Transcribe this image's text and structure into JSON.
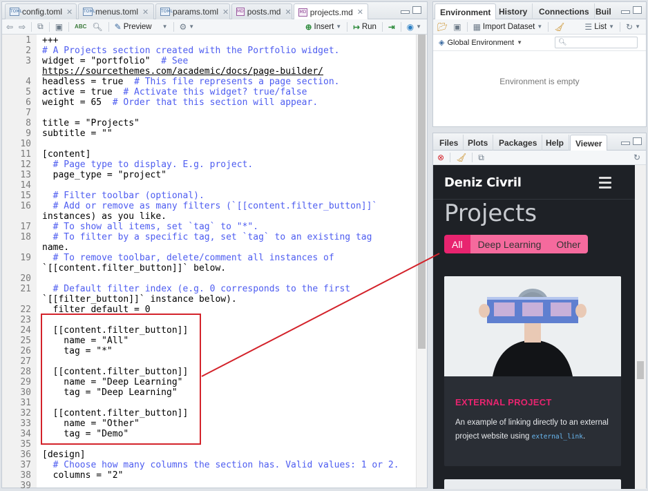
{
  "editor": {
    "tabs": [
      {
        "label": "config.toml",
        "icon": "toml-file-icon",
        "badge": "TOML"
      },
      {
        "label": "menus.toml",
        "icon": "toml-file-icon",
        "badge": "TOML"
      },
      {
        "label": "params.toml",
        "icon": "toml-file-icon",
        "badge": "TOML"
      },
      {
        "label": "posts.md",
        "icon": "md-file-icon",
        "badge": "MD"
      },
      {
        "label": "projects.md",
        "icon": "md-file-icon",
        "badge": "MD",
        "active": true
      }
    ],
    "toolbar": {
      "preview_label": "Preview",
      "insert_label": "Insert",
      "run_label": "Run",
      "spellcheck_badge": "ABC"
    },
    "code_lines": [
      {
        "n": "1",
        "text": "+++"
      },
      {
        "n": "2",
        "text": "# A Projects section created with the Portfolio widget.",
        "comment": true
      },
      {
        "n": "3",
        "text": "widget = \"portfolio\"  # See"
      },
      {
        "n": "",
        "text": "https://sourcethemes.com/academic/docs/page-builder/",
        "url": true
      },
      {
        "n": "4",
        "text": "headless = true  # This file represents a page section."
      },
      {
        "n": "5",
        "text": "active = true  # Activate this widget? true/false"
      },
      {
        "n": "6",
        "text": "weight = 65  # Order that this section will appear."
      },
      {
        "n": "7",
        "text": ""
      },
      {
        "n": "8",
        "text": "title = \"Projects\""
      },
      {
        "n": "9",
        "text": "subtitle = \"\""
      },
      {
        "n": "10",
        "text": ""
      },
      {
        "n": "11",
        "text": "[content]"
      },
      {
        "n": "12",
        "text": "  # Page type to display. E.g. project."
      },
      {
        "n": "13",
        "text": "  page_type = \"project\""
      },
      {
        "n": "14",
        "text": ""
      },
      {
        "n": "15",
        "text": "  # Filter toolbar (optional)."
      },
      {
        "n": "16",
        "text": "  # Add or remove as many filters (`[[content.filter_button]]`"
      },
      {
        "n": "",
        "text": "instances) as you like."
      },
      {
        "n": "17",
        "text": "  # To show all items, set `tag` to \"*\"."
      },
      {
        "n": "18",
        "text": "  # To filter by a specific tag, set `tag` to an existing tag"
      },
      {
        "n": "",
        "text": "name."
      },
      {
        "n": "19",
        "text": "  # To remove toolbar, delete/comment all instances of"
      },
      {
        "n": "",
        "text": "`[[content.filter_button]]` below."
      },
      {
        "n": "20",
        "text": ""
      },
      {
        "n": "21",
        "text": "  # Default filter index (e.g. 0 corresponds to the first"
      },
      {
        "n": "",
        "text": "`[[filter_button]]` instance below)."
      },
      {
        "n": "22",
        "text": "  filter_default = 0"
      },
      {
        "n": "23",
        "text": ""
      },
      {
        "n": "24",
        "text": "  [[content.filter_button]]"
      },
      {
        "n": "25",
        "text": "    name = \"All\""
      },
      {
        "n": "26",
        "text": "    tag = \"*\""
      },
      {
        "n": "27",
        "text": ""
      },
      {
        "n": "28",
        "text": "  [[content.filter_button]]"
      },
      {
        "n": "29",
        "text": "    name = \"Deep Learning\""
      },
      {
        "n": "30",
        "text": "    tag = \"Deep Learning\""
      },
      {
        "n": "31",
        "text": ""
      },
      {
        "n": "32",
        "text": "  [[content.filter_button]]"
      },
      {
        "n": "33",
        "text": "    name = \"Other\""
      },
      {
        "n": "34",
        "text": "    tag = \"Demo\""
      },
      {
        "n": "35",
        "text": ""
      },
      {
        "n": "36",
        "text": "[design]"
      },
      {
        "n": "37",
        "text": "  # Choose how many columns the section has. Valid values: 1 or 2."
      },
      {
        "n": "38",
        "text": "  columns = \"2\""
      },
      {
        "n": "39",
        "text": ""
      }
    ]
  },
  "env_pane": {
    "tabs": [
      "Environment",
      "History",
      "Connections",
      "Buil"
    ],
    "import_label": "Import Dataset",
    "list_label": "List",
    "scope_label": "Global Environment",
    "empty_message": "Environment is empty"
  },
  "viewer_pane": {
    "tabs": [
      "Files",
      "Plots",
      "Packages",
      "Help",
      "Viewer"
    ],
    "site": {
      "brand": "Deniz Civril",
      "section_title": "Projects",
      "filters": [
        "All",
        "Deep Learning",
        "Other"
      ],
      "card": {
        "label": "EXTERNAL PROJECT",
        "desc_before": "An example of linking directly to an external project website using ",
        "desc_code": "external_link",
        "desc_after": "."
      }
    }
  },
  "colors": {
    "annotation": "#d3222a",
    "filter_active": "#e8246f",
    "filter_inactive": "#f56a9d",
    "comment": "#4d5cf0",
    "site_bg": "#1e2126"
  }
}
